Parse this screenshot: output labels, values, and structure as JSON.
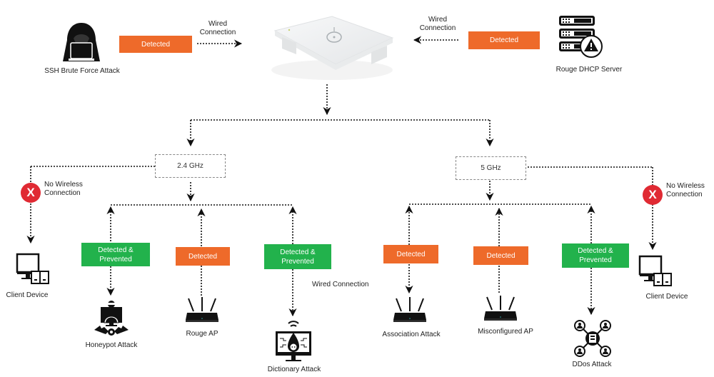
{
  "colors": {
    "detected": "#ee6a2a",
    "prevented": "#22b24c",
    "blocked": "#e02a33",
    "line": "#111111"
  },
  "top": {
    "left_source": {
      "label": "SSH Brute Force Attack",
      "icon": "hacker-laptop-icon",
      "status": "Detected",
      "link": "Wired\nConnection"
    },
    "right_source": {
      "label": "Rouge DHCP Server",
      "icon": "server-warning-icon",
      "status": "Detected",
      "link": "Wired\nConnection"
    },
    "center_device": {
      "icon": "sensor-device-icon"
    }
  },
  "bands": [
    {
      "label": "2.4 GHz",
      "no_wireless": {
        "label": "No Wireless Connection",
        "line1": "No Wireless",
        "line2": "Connection",
        "icon": "x-circle-icon",
        "symbol": "X"
      },
      "client": {
        "label": "Client Device",
        "icon": "client-device-icon"
      },
      "branches": [
        {
          "status": "Detected & Prevented",
          "status_line1": "Detected &",
          "status_line2": "Prevented",
          "type": "prevented",
          "target": "Honeypot Attack",
          "icon": "honeypot-icon"
        },
        {
          "status": "Detected",
          "type": "detected",
          "target": "Rouge AP",
          "icon": "router-icon"
        },
        {
          "status": "Detected & Prevented",
          "status_line1": "Detected &",
          "status_line2": "Prevented",
          "type": "prevented",
          "target": "Dictionary Attack",
          "icon": "dictionary-attack-icon",
          "extra_label": "Wired Connection"
        }
      ]
    },
    {
      "label": "5 GHz",
      "no_wireless": {
        "label": "No Wireless Connection",
        "line1": "No Wireless",
        "line2": "Connection",
        "icon": "x-circle-icon",
        "symbol": "X"
      },
      "client": {
        "label": "Client Device",
        "icon": "client-device-icon"
      },
      "branches": [
        {
          "status": "Detected",
          "type": "detected",
          "target": "Association Attack",
          "icon": "router-icon"
        },
        {
          "status": "Detected",
          "type": "detected",
          "target": "Misconfigured AP",
          "icon": "router-icon"
        },
        {
          "status": "Detected & Prevented",
          "status_line1": "Detected &",
          "status_line2": "Prevented",
          "type": "prevented",
          "target": "DDos Attack",
          "icon": "ddos-network-icon"
        }
      ]
    }
  ]
}
